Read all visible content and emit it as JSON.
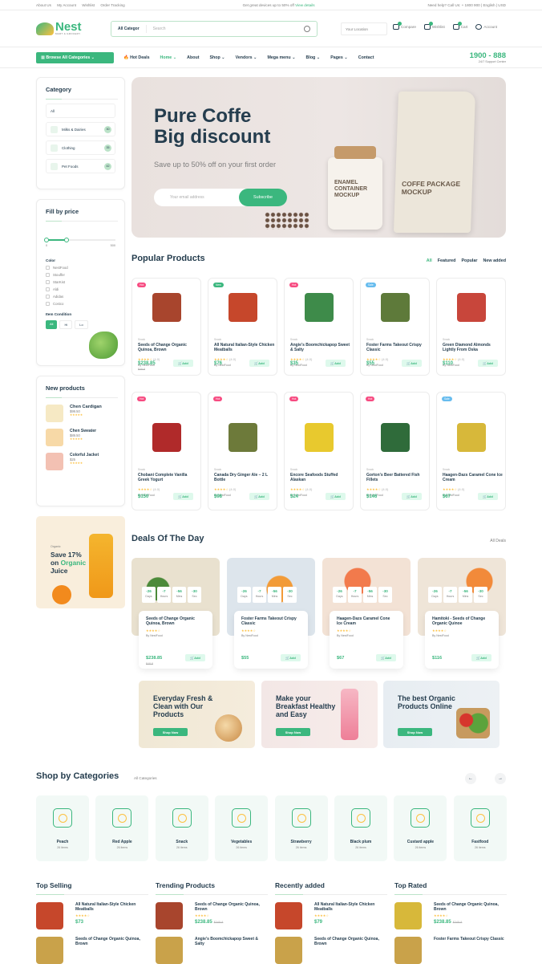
{
  "topbar": {
    "links": [
      "About Us",
      "My Account",
      "Wishlist",
      "Order Tracking"
    ],
    "message": "Get great devices up to 50% off",
    "message_link": "View details",
    "help": "Need help? Call Us: + 1800 900",
    "language": "English",
    "currency": "USD"
  },
  "header": {
    "logo_text": "Nest",
    "logo_sub": "MART & GROCERY",
    "search_category": "All Categor",
    "search_placeholder": "Search",
    "location": "Your Location",
    "compare": "Compare",
    "wishlist": "Wishlist",
    "cart": "Cart",
    "account": "Account"
  },
  "nav": {
    "browse": "Browse All Categories",
    "items": [
      "Hot Deals",
      "Home",
      "About",
      "Shop",
      "Vendors",
      "Mega menu",
      "Blog",
      "Pages",
      "Contact"
    ],
    "support_number": "1900 - 888",
    "support_label": "24/7 Support Center"
  },
  "sidebar": {
    "category_title": "Category",
    "category_all": "All",
    "categories": [
      {
        "name": "Milks & Dairies",
        "count": "30"
      },
      {
        "name": "Clothing",
        "count": "35"
      },
      {
        "name": "Pet Foods",
        "count": "42"
      }
    ],
    "price_title": "Fill by price",
    "price_min": "0",
    "price_max": "500",
    "color_title": "Color",
    "colors": [
      "NestFood",
      "Stouffer",
      "StarKist",
      "Aldi",
      "Adidas",
      "Costco"
    ],
    "condition_title": "Item Condition",
    "conditions": [
      "All",
      "Hi",
      "Lo"
    ],
    "new_title": "New products",
    "new_products": [
      {
        "name": "Chen Cardigan",
        "price": "$99.50"
      },
      {
        "name": "Chen Sweater",
        "price": "$89.50"
      },
      {
        "name": "Colorful Jacket",
        "price": "$25"
      }
    ],
    "promo_small": "Organic",
    "promo_line1": "Save 17%",
    "promo_line2": "on",
    "promo_accent": "Organic",
    "promo_line3": "Juice"
  },
  "hero": {
    "title_line1": "Pure Coffe",
    "title_line2": "Big discount",
    "subtitle": "Save up to 50% off on your first order",
    "email_placeholder": "Your email address",
    "subscribe": "Subscribe",
    "jar_label": "ENAMEL CONTAINER MOCKUP",
    "bag_label": "COFFE PACKAGE MOCKUP"
  },
  "popular": {
    "title": "Popular Products",
    "tabs": [
      "All",
      "Featured",
      "Popular",
      "New added"
    ],
    "products": [
      {
        "badge": "Hot",
        "name": "Seeds of Change Organic Quinoa, Brown",
        "price": "$238.85",
        "old": "$48.8",
        "color": "#a8452d"
      },
      {
        "badge": "New",
        "name": "All Natural Italian-Style Chicken Meatballs",
        "price": "$76",
        "old": "",
        "color": "#c6472b"
      },
      {
        "badge": "Hot",
        "name": "Angie's Boomchickapop Sweet & Salty",
        "price": "$35",
        "old": "",
        "color": "#3e8b4a"
      },
      {
        "badge": "Sale",
        "name": "Foster Farms Takeout Crispy Classic",
        "price": "$55",
        "old": "",
        "color": "#5e7a3a"
      },
      {
        "badge": "",
        "name": "Green Diamond Almonds Lightly From Oska",
        "price": "$110",
        "old": "",
        "color": "#c8463b"
      },
      {
        "badge": "Hot",
        "name": "Chobani Complete Vanilla Greek Yogurt",
        "price": "$150",
        "old": "",
        "color": "#b02a2a"
      },
      {
        "badge": "Hot",
        "name": "Canada Dry Ginger Ale – 2 L Bottle",
        "price": "$98",
        "old": "",
        "color": "#6d7a3a"
      },
      {
        "badge": "Hot",
        "name": "Encore Seafoods Stuffed Alaskan",
        "price": "$24",
        "old": "",
        "color": "#e8c92e"
      },
      {
        "badge": "Hot",
        "name": "Gorton's Beer Battered Fish Fillets",
        "price": "$146",
        "old": "",
        "color": "#2f6b3a"
      },
      {
        "badge": "Sale",
        "name": "Haagen-Dazs Caramel Cone Ice Cream",
        "price": "$67",
        "old": "",
        "color": "#d7b83a"
      }
    ],
    "by": "By NestFood",
    "rating": "(4.0)",
    "add": "Add",
    "category": "Snack"
  },
  "deals": {
    "title": "Deals Of The Day",
    "all": "All Deals",
    "timer_values": [
      "-26",
      "-7",
      "-56",
      "-30"
    ],
    "timer_labels": [
      "Days",
      "Hours",
      "Mins",
      "Sec"
    ],
    "items": [
      {
        "name": "Seeds of Change Organic Quinoa, Brown",
        "price": "$238.85",
        "old": "$48.8"
      },
      {
        "name": "Foster Farms Takeout Crispy Classic",
        "price": "$55",
        "old": ""
      },
      {
        "name": "Haagen-Dazs Caramel Cone Ice Cream",
        "price": "$67",
        "old": ""
      },
      {
        "name": "Hamitoki - Seeds of Change Organic Quinoe",
        "price": "$116",
        "old": ""
      }
    ]
  },
  "banners": [
    {
      "text": "Everyday Fresh & Clean with Our Products",
      "button": "Shop Now"
    },
    {
      "text": "Make your Breakfast Healthy and Easy",
      "button": "Shop Now"
    },
    {
      "text": "The best Organic Products Online",
      "button": "Shop Now"
    }
  ],
  "shop_categories": {
    "title": "Shop by Categories",
    "all": "All Categories",
    "items": [
      {
        "name": "Peach",
        "count": "26 items"
      },
      {
        "name": "Red Apple",
        "count": "26 items"
      },
      {
        "name": "Snack",
        "count": "26 items"
      },
      {
        "name": "Vegetables",
        "count": "26 items"
      },
      {
        "name": "Strawberry",
        "count": "26 items"
      },
      {
        "name": "Black plum",
        "count": "26 items"
      },
      {
        "name": "Custard apple",
        "count": "26 items"
      },
      {
        "name": "Fastfood",
        "count": "26 items"
      }
    ]
  },
  "bottom": {
    "columns": [
      {
        "title": "Top Selling",
        "items": [
          {
            "name": "All Natural Italian-Style Chicken Meatballs",
            "price": "$73",
            "old": ""
          },
          {
            "name": "Seeds of Change Organic Quinoa, Brown",
            "price": "",
            "old": ""
          }
        ]
      },
      {
        "title": "Trending Products",
        "items": [
          {
            "name": "Seeds of Change Organic Quinoa, Brown",
            "price": "$238.85",
            "old": "$245.8"
          },
          {
            "name": "Angie's Boomchickapop Sweet & Salty",
            "price": "",
            "old": ""
          }
        ]
      },
      {
        "title": "Recently added",
        "items": [
          {
            "name": "All Natural Italian-Style Chicken Meatballs",
            "price": "$79",
            "old": ""
          },
          {
            "name": "Seeds of Change Organic Quinoa, Brown",
            "price": "",
            "old": ""
          }
        ]
      },
      {
        "title": "Top Rated",
        "items": [
          {
            "name": "Seeds of Change Organic Quinoa, Brown",
            "price": "$238.85",
            "old": "$245.8"
          },
          {
            "name": "Foster Farms Takeout Crispy Classic",
            "price": "",
            "old": ""
          }
        ]
      }
    ]
  }
}
